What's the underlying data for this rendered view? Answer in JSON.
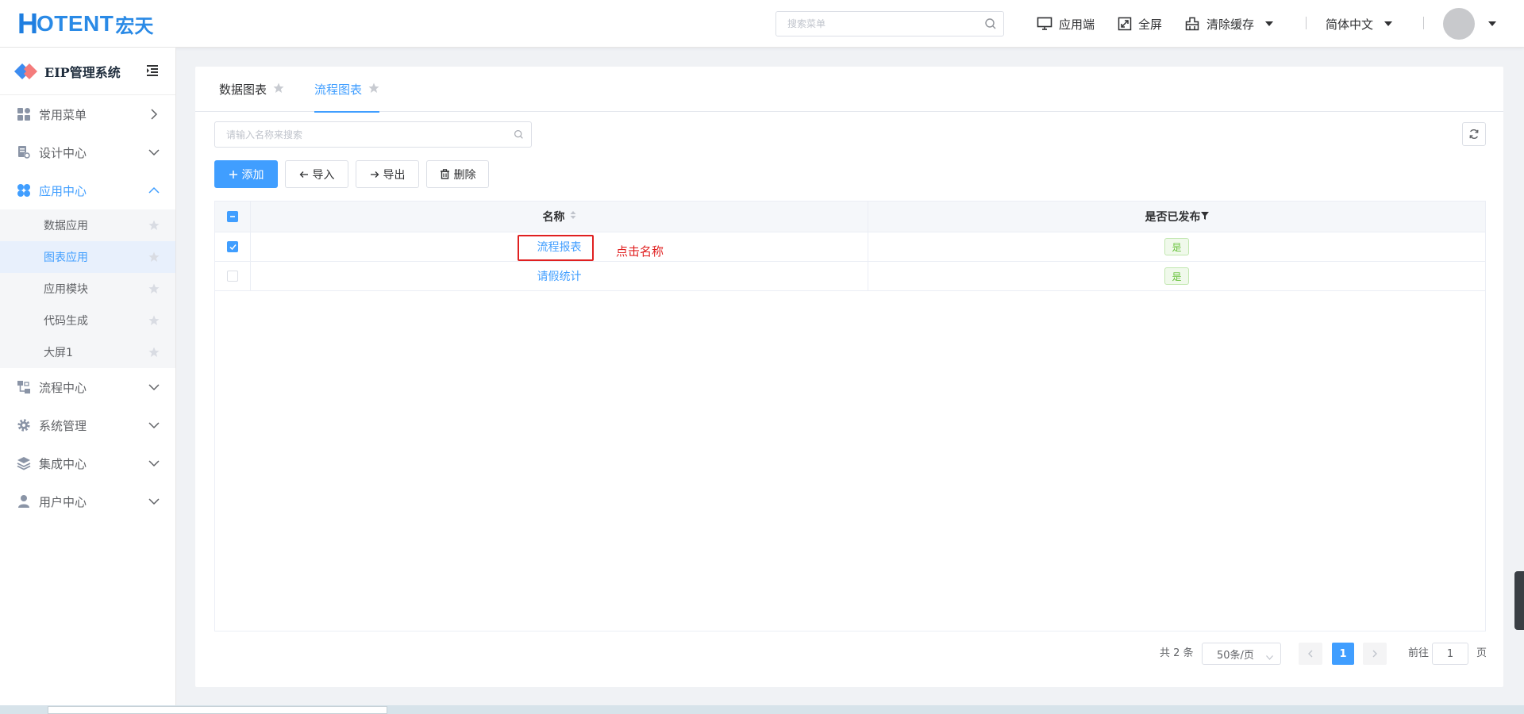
{
  "header": {
    "logo_mark": "H",
    "logo_text": "OTENT",
    "logo_cn": "宏天",
    "search_placeholder": "搜索菜单",
    "app_client": "应用端",
    "fullscreen": "全屏",
    "clear_cache": "清除缓存",
    "language": "简体中文"
  },
  "sidebar": {
    "system_title": "EIP管理系统",
    "menus": [
      {
        "label": "常用菜单"
      },
      {
        "label": "设计中心"
      },
      {
        "label": "应用中心"
      },
      {
        "label": "流程中心"
      },
      {
        "label": "系统管理"
      },
      {
        "label": "集成中心"
      },
      {
        "label": "用户中心"
      }
    ],
    "app_center_sub": [
      {
        "label": "数据应用"
      },
      {
        "label": "图表应用"
      },
      {
        "label": "应用模块"
      },
      {
        "label": "代码生成"
      },
      {
        "label": "大屏1"
      }
    ]
  },
  "tabs": [
    {
      "label": "数据图表"
    },
    {
      "label": "流程图表"
    }
  ],
  "search": {
    "placeholder": "请输入名称来搜索"
  },
  "toolbar": {
    "add": "添加",
    "import": "导入",
    "export": "导出",
    "delete": "删除"
  },
  "table": {
    "columns": [
      "名称",
      "是否已发布"
    ],
    "rows": [
      {
        "name": "流程报表",
        "published": "是",
        "checked": true
      },
      {
        "name": "请假统计",
        "published": "是",
        "checked": false
      }
    ]
  },
  "annotation": "点击名称",
  "pagination": {
    "total_text": "共 2 条",
    "page_size": "50条/页",
    "current_page": "1",
    "goto_prefix": "前往",
    "goto_value": "1",
    "goto_suffix": "页"
  },
  "colors": {
    "primary": "#409eff",
    "annotation_red": "#e02020",
    "tag_green": "#67c23a"
  }
}
